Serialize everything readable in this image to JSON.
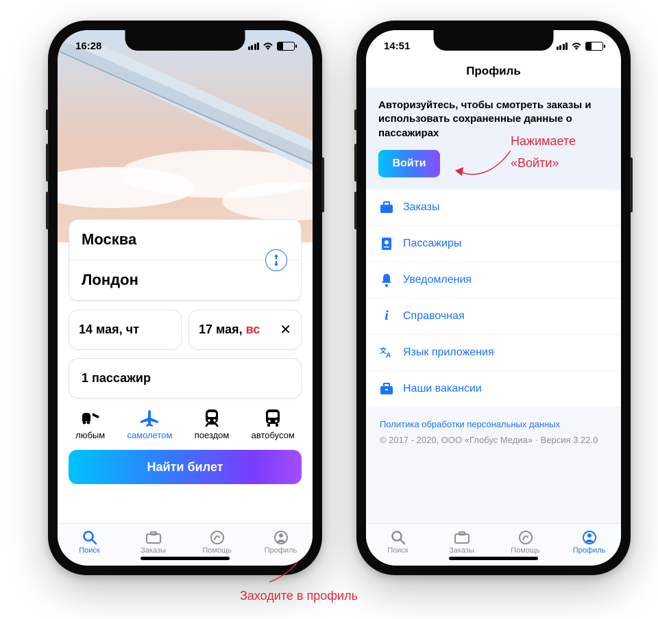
{
  "phone1": {
    "status_time": "16:28",
    "from_city": "Москва",
    "to_city": "Лондон",
    "depart_date": "14 мая, чт",
    "return_date_prefix": "17 мая, ",
    "return_date_day": "вс",
    "passengers": "1 пассажир",
    "transport": [
      {
        "label": "любым",
        "active": false,
        "icon": "mixed"
      },
      {
        "label": "самолетом",
        "active": true,
        "icon": "plane"
      },
      {
        "label": "поездом",
        "active": false,
        "icon": "train"
      },
      {
        "label": "автобусом",
        "active": false,
        "icon": "bus"
      }
    ],
    "search_button": "Найти билет",
    "tabs": [
      {
        "label": "Поиск",
        "icon": "search",
        "active": true
      },
      {
        "label": "Заказы",
        "icon": "orders",
        "active": false
      },
      {
        "label": "Помощь",
        "icon": "help",
        "active": false
      },
      {
        "label": "Профиль",
        "icon": "profile",
        "active": false
      }
    ]
  },
  "phone2": {
    "status_time": "14:51",
    "title": "Профиль",
    "login_message": "Авторизуйтесь, чтобы смотреть заказы и использовать сохраненные данные о пассажирах",
    "login_button": "Войти",
    "menu": [
      {
        "label": "Заказы",
        "icon": "briefcase"
      },
      {
        "label": "Пассажиры",
        "icon": "passport"
      },
      {
        "label": "Уведомления",
        "icon": "bell"
      },
      {
        "label": "Справочная",
        "icon": "info"
      },
      {
        "label": "Язык приложения",
        "icon": "lang"
      },
      {
        "label": "Наши вакансии",
        "icon": "jobs"
      }
    ],
    "policy": "Политика обработки персональных данных",
    "copyright": "© 2017 - 2020, ООО «Глобус Медиа» · Версия 3.22.0",
    "tabs": [
      {
        "label": "Поиск",
        "icon": "search",
        "active": false
      },
      {
        "label": "Заказы",
        "icon": "orders",
        "active": false
      },
      {
        "label": "Помощь",
        "icon": "help",
        "active": false
      },
      {
        "label": "Профиль",
        "icon": "profile",
        "active": true
      }
    ]
  },
  "annotations": {
    "bottom": "Заходите в профиль",
    "right_line1": "Нажимаете",
    "right_line2": "«Войти»"
  },
  "colors": {
    "accent": "#1a73ff",
    "danger": "#e5243a"
  }
}
